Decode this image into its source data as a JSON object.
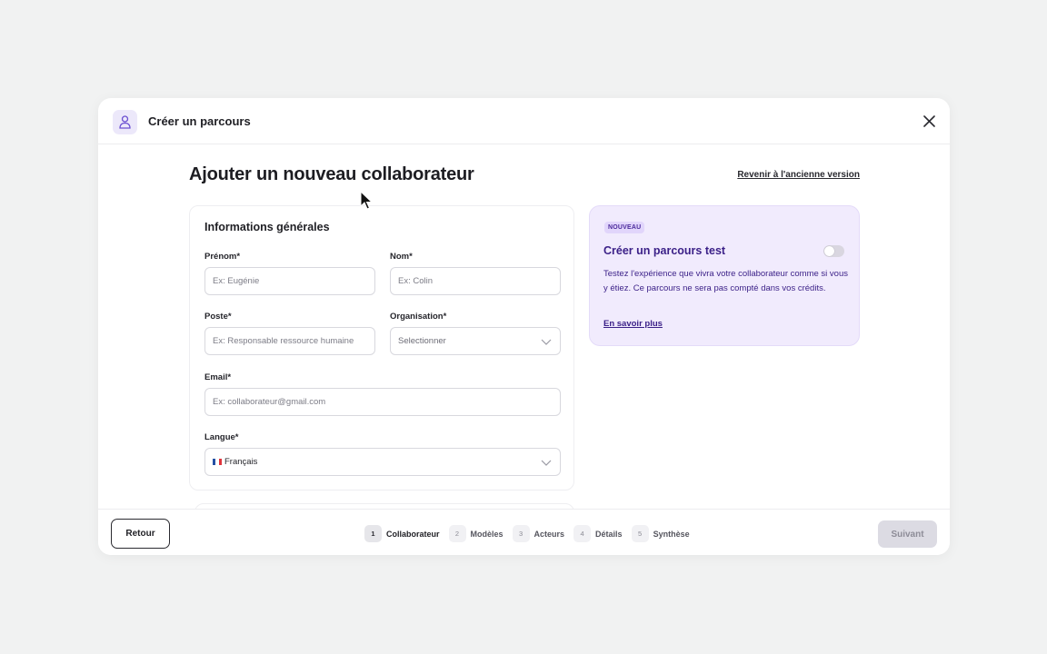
{
  "header": {
    "title": "Créer un parcours"
  },
  "page": {
    "title": "Ajouter un nouveau collaborateur",
    "old_version_link": "Revenir à l'ancienne version"
  },
  "form": {
    "section_title": "Informations générales",
    "first_name": {
      "label": "Prénom*",
      "placeholder": "Ex: Eugénie"
    },
    "last_name": {
      "label": "Nom*",
      "placeholder": "Ex: Colin"
    },
    "position": {
      "label": "Poste*",
      "placeholder": "Ex: Responsable ressource humaine"
    },
    "organisation": {
      "label": "Organisation*",
      "placeholder": "Selectionner"
    },
    "email": {
      "label": "Email*",
      "placeholder": "Ex: collaborateur@gmail.com"
    },
    "language": {
      "label": "Langue*",
      "value": "Français"
    }
  },
  "promo": {
    "badge": "NOUVEAU",
    "title": "Créer un parcours test",
    "description": "Testez l'expérience que vivra votre collaborateur comme si vous y étiez. Ce parcours ne sera pas compté dans vos crédits.",
    "link": "En savoir plus",
    "toggle_on": false
  },
  "footer": {
    "back_label": "Retour",
    "next_label": "Suivant",
    "steps": [
      {
        "num": "1",
        "label": "Collaborateur",
        "active": true
      },
      {
        "num": "2",
        "label": "Modèles",
        "active": false
      },
      {
        "num": "3",
        "label": "Acteurs",
        "active": false
      },
      {
        "num": "4",
        "label": "Détails",
        "active": false
      },
      {
        "num": "5",
        "label": "Synthèse",
        "active": false
      }
    ]
  },
  "colors": {
    "accent": "#3a1f87",
    "promo_bg": "#f1ebfd",
    "next_disabled_bg": "#dcdbe3"
  },
  "icons": [
    "user-icon",
    "close-icon",
    "chevron-down-icon",
    "flag-fr-icon",
    "cursor-pointer-icon"
  ]
}
